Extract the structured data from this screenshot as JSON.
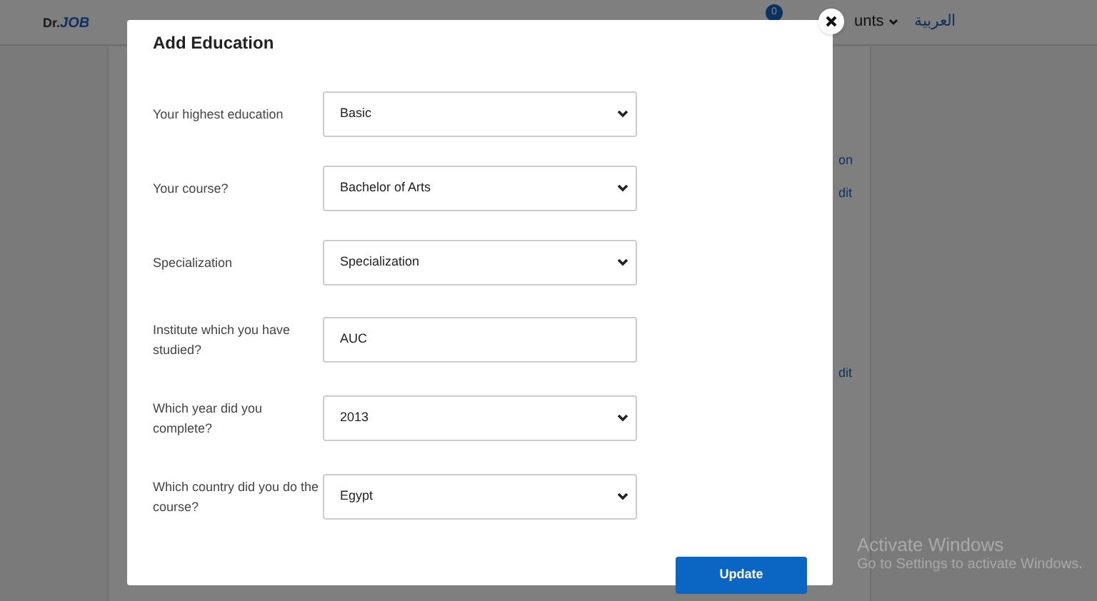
{
  "header": {
    "logo_prefix": "Dr.",
    "logo_mark": "JOB",
    "message_badge": "0",
    "account_right": "unts",
    "language": "العربية"
  },
  "background_fragments": [
    "on",
    "dit",
    "dit"
  ],
  "dialog": {
    "title": "Add Education",
    "fields": [
      {
        "kind": "select",
        "label": "Your highest education",
        "value": "Basic"
      },
      {
        "kind": "select",
        "label": "Your course?",
        "value": "Bachelor of Arts"
      },
      {
        "kind": "select",
        "label": "Specialization",
        "value": "Specialization"
      },
      {
        "kind": "input",
        "label": "Institute which you have studied?",
        "value": "AUC"
      },
      {
        "kind": "select",
        "label": "Which year did you complete?",
        "value": "2013"
      },
      {
        "kind": "select",
        "label": "Which country did you do the course?",
        "value": "Egypt"
      }
    ],
    "submit": "Update"
  },
  "os_notice": {
    "title": "Activate Windows",
    "text": "Go to Settings to activate Windows."
  }
}
